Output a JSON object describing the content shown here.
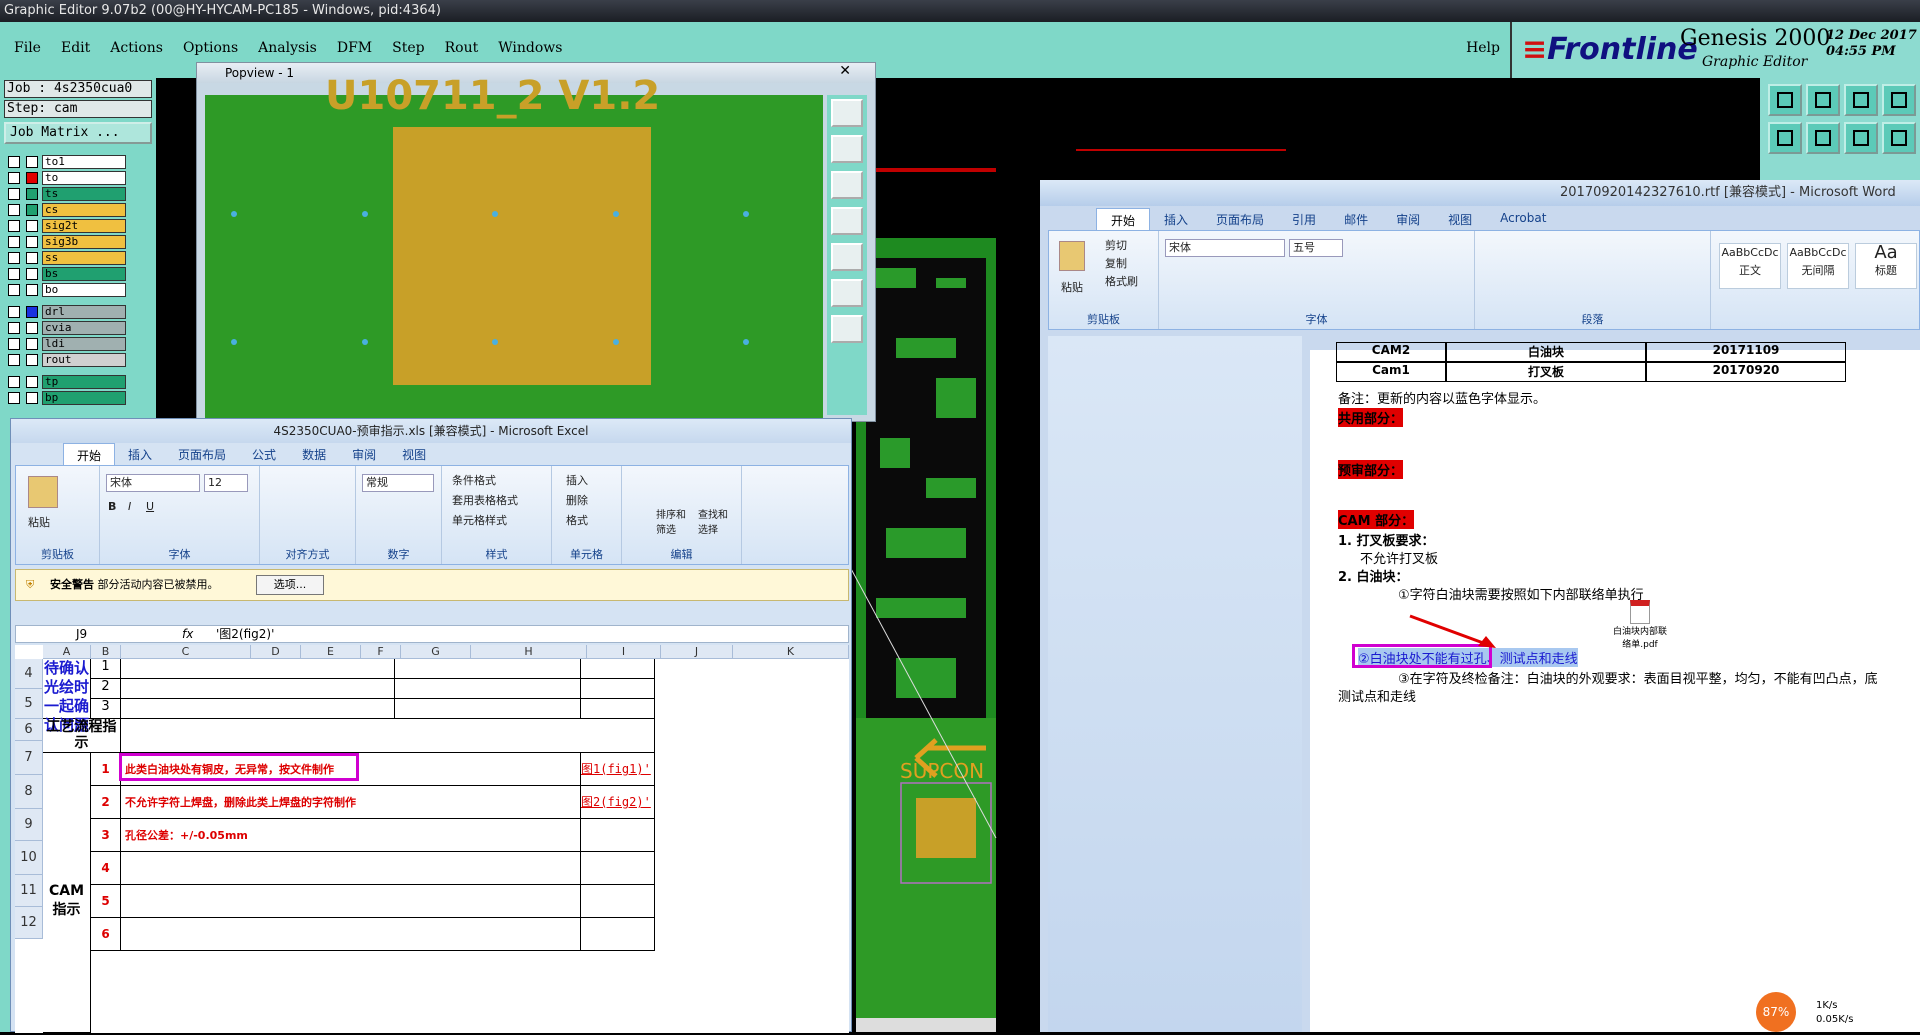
{
  "app": {
    "title": "Graphic Editor 9.07b2 (00@HY-HYCAM-PC185 - Windows, pid:4364)"
  },
  "genesis": {
    "menu": [
      "File",
      "Edit",
      "Actions",
      "Options",
      "Analysis",
      "DFM",
      "Step",
      "Rout",
      "Windows"
    ],
    "help": "Help",
    "brand_logo": "Frontline",
    "brand_name": "Genesis 2000",
    "brand_sub": "Graphic Editor",
    "date": "12 Dec 2017",
    "time": "04:55 PM",
    "job": "Job : 4s2350cua0",
    "step": "Step: cam",
    "job_matrix": "Job Matrix ...",
    "layers": [
      {
        "name": "to1",
        "color": "#ffffff",
        "state": "#ffffff"
      },
      {
        "name": "to",
        "color": "#ffffff",
        "state": "#e00000"
      },
      {
        "name": "ts",
        "color": "#20a070",
        "state": "#20a070"
      },
      {
        "name": "cs",
        "color": "#f0c040",
        "state": "#20a070"
      },
      {
        "name": "sig2t",
        "color": "#f0c040",
        "state": "#ffffff"
      },
      {
        "name": "sig3b",
        "color": "#f0c040",
        "state": "#ffffff"
      },
      {
        "name": "ss",
        "color": "#f0c040",
        "state": "#ffffff"
      },
      {
        "name": "bs",
        "color": "#20a070",
        "state": "#ffffff"
      },
      {
        "name": "bo",
        "color": "#ffffff",
        "state": "#ffffff"
      },
      {
        "name": "drl",
        "color": "#a0b0b0",
        "state": "#1a30e0"
      },
      {
        "name": "cvia",
        "color": "#a0b0b0",
        "state": "#ffffff"
      },
      {
        "name": "ldi",
        "color": "#a0b0b0",
        "state": "#ffffff"
      },
      {
        "name": "rout",
        "color": "#d0d0d0",
        "state": "#ffffff"
      },
      {
        "name": "tp",
        "color": "#20a070",
        "state": "#ffffff"
      },
      {
        "name": "bp",
        "color": "#20a070",
        "state": "#ffffff"
      }
    ],
    "board_text": "SUPCON",
    "board_subtext": "U10711_2 V1.2"
  },
  "popview": {
    "title": "Popview - 1",
    "top_text": "U10711_2 V1.2"
  },
  "excel": {
    "title": "4S2350CUA0-预审指示.xls [兼容模式] - Microsoft Excel",
    "tabs": [
      "开始",
      "插入",
      "页面布局",
      "公式",
      "数据",
      "审阅",
      "视图"
    ],
    "groups": [
      "剪贴板",
      "字体",
      "对齐方式",
      "数字",
      "样式",
      "单元格",
      "编辑"
    ],
    "paste": "粘贴",
    "font_name": "宋体",
    "font_size": "12",
    "number_format": "常规",
    "style_items": [
      "条件格式",
      "套用表格格式",
      "单元格样式"
    ],
    "cell_items": [
      "插入",
      "删除",
      "格式"
    ],
    "sort_label": "排序和筛选",
    "find_label": "查找和选择",
    "security_label": "安全警告",
    "security_text": "部分活动内容已被禁用。",
    "security_button": "选项...",
    "name_box": "J9",
    "formula": "'图2(fig2)'",
    "columns": [
      "A",
      "B",
      "C",
      "D",
      "E",
      "F",
      "G",
      "H",
      "I",
      "J",
      "K"
    ],
    "rows": [
      "4",
      "5",
      "6",
      "7",
      "8",
      "9",
      "10",
      "11",
      "12"
    ],
    "pending_label": "待确认光绘时一起确认问题",
    "pending_nums": [
      "1",
      "2",
      "3"
    ],
    "process_label": "工艺流程指示",
    "cam_label": "CAM指示",
    "cam_nums": [
      "1",
      "2",
      "3",
      "4",
      "5",
      "6"
    ],
    "cam_items": [
      "此类白油块处有铜皮，无异常，按文件制作",
      "不允许字符上焊盘，删除此类上焊盘的字符制作",
      "孔径公差：+/-0.05mm"
    ],
    "links": [
      "图1(fig1)'",
      "图2(fig2)'"
    ]
  },
  "word": {
    "title": "20170920142327610.rtf [兼容模式] - Microsoft Word",
    "tabs": [
      "开始",
      "插入",
      "页面布局",
      "引用",
      "邮件",
      "审阅",
      "视图",
      "Acrobat"
    ],
    "groups": [
      "剪贴板",
      "字体",
      "段落"
    ],
    "clip_items": [
      "剪切",
      "复制",
      "格式刷"
    ],
    "paste": "粘贴",
    "font_name": "宋体",
    "font_size": "五号",
    "styles": [
      "AaBbCcDc",
      "AaBbCcDc",
      "Aa"
    ],
    "style_names": [
      "正文",
      "无间隔",
      "标题"
    ],
    "table": [
      {
        "a": "CAM2",
        "b": "白油块",
        "c": "20171109"
      },
      {
        "a": "Cam1",
        "b": "打叉板",
        "c": "20170920"
      }
    ],
    "note": "备注：更新的内容以蓝色字体显示。",
    "common": "共用部分：",
    "pre": "预审部分：",
    "cam": "CAM 部分：",
    "item1": "1. 打叉板要求：",
    "item1_sub": "不允许打叉板",
    "item2": "2. 白油块：",
    "item2_a": "①字符白油块需要按照如下内部联络单执行",
    "pdf_label": "白油块内部联络单.pdf",
    "item2_b": "②白油块处不能有过孔、测试点和走线",
    "item2_c": "③在字符及终检备注：白油块的外观要求：表面目视平整，均匀，不能有凹凸点，底",
    "item2_c2": "测试点和走线"
  },
  "tray": {
    "percent": "87%",
    "up": "1K/s",
    "down": "0.05K/s"
  }
}
